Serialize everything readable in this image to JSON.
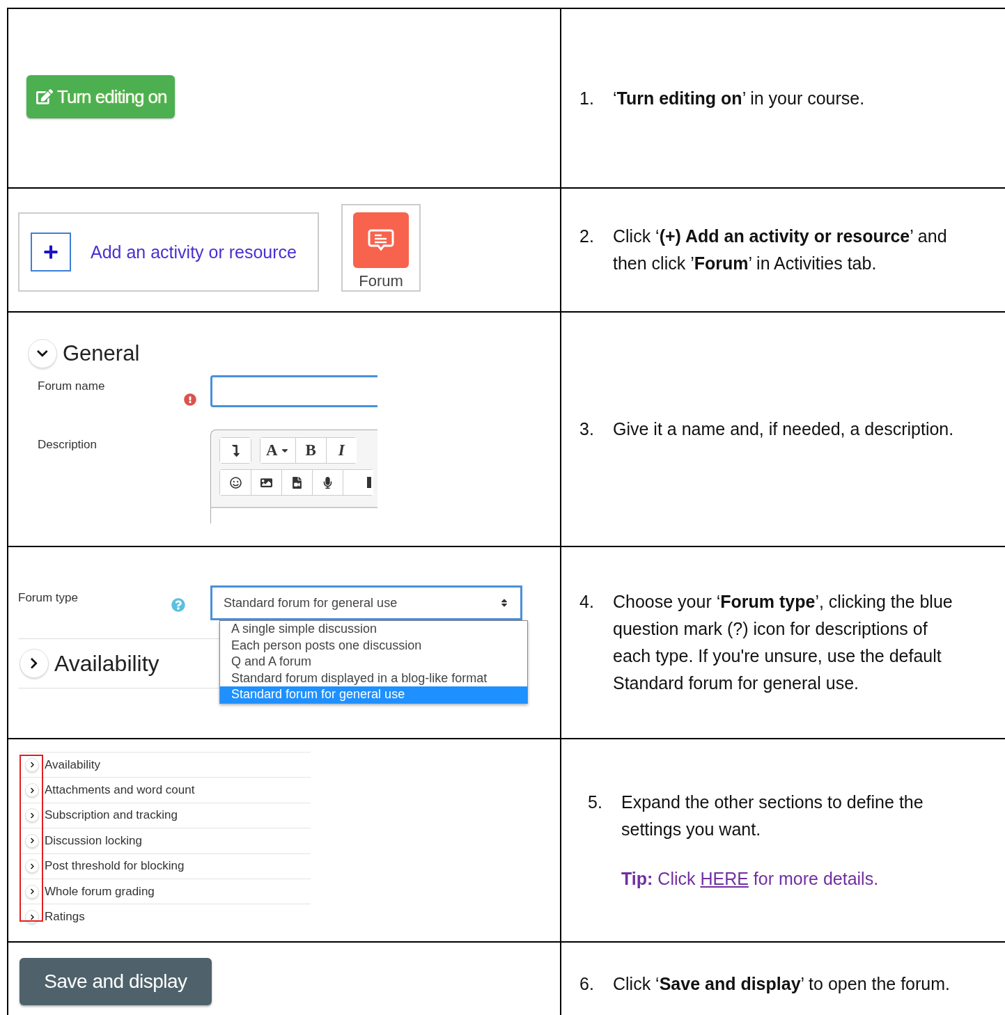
{
  "steps": [
    {
      "number": "1.",
      "text": "‘**Turn editing on**’ in your course.",
      "demo": {
        "kind": "edit_button",
        "label": "Turn editing on"
      }
    },
    {
      "number": "2.",
      "text": "Click ‘**(+) Add an activity or resource**’ and then click ’**Forum**’ in Activities tab.",
      "demo": {
        "kind": "add_activity",
        "label": "Add an activity or resource",
        "tile_label": "Forum"
      }
    },
    {
      "number": "3.",
      "text": "Give it a name and, if needed, a description.",
      "demo": {
        "kind": "general_form",
        "heading": "General",
        "name_label": "Forum name",
        "description_label": "Description",
        "toolbar_rows": [
          [
            {
              "kind": "collapse"
            },
            {
              "kind": "font",
              "label": "A"
            },
            {
              "kind": "bold",
              "label": "B"
            },
            {
              "kind": "italic",
              "label": "I"
            }
          ],
          [
            {
              "kind": "emoji"
            },
            {
              "kind": "image"
            },
            {
              "kind": "media"
            },
            {
              "kind": "mic"
            },
            {
              "kind": "more"
            }
          ]
        ]
      }
    },
    {
      "number": "4.",
      "text": "Choose your ‘**Forum type**’, clicking the blue question mark (?) icon for descriptions of each type. If you're unsure, use the default Standard forum for general use.",
      "demo": {
        "kind": "forum_type",
        "label": "Forum type",
        "value": "Standard forum for general use",
        "options": [
          {
            "label": "A single simple discussion",
            "selected": false
          },
          {
            "label": "Each person posts one discussion",
            "selected": false
          },
          {
            "label": "Q and A forum",
            "selected": false
          },
          {
            "label": "Standard forum displayed in a blog-like format",
            "selected": false
          },
          {
            "label": "Standard forum for general use",
            "selected": true
          }
        ],
        "section": "Availability"
      }
    },
    {
      "number": "5.",
      "text": "Expand the other sections to define the settings you want.",
      "tip": {
        "prefix": "**Tip:** Click ",
        "link": "HERE",
        "suffix": " for more details."
      },
      "demo": {
        "kind": "section_list",
        "sections": [
          "Availability",
          "Attachments and word count",
          "Subscription and tracking",
          "Discussion locking",
          "Post threshold for blocking",
          "Whole forum grading",
          "Ratings"
        ]
      }
    },
    {
      "number": "6.",
      "text": "Click ‘**Save and display**’ to open the forum.",
      "demo": {
        "kind": "save_button",
        "label": "Save and display"
      }
    }
  ]
}
